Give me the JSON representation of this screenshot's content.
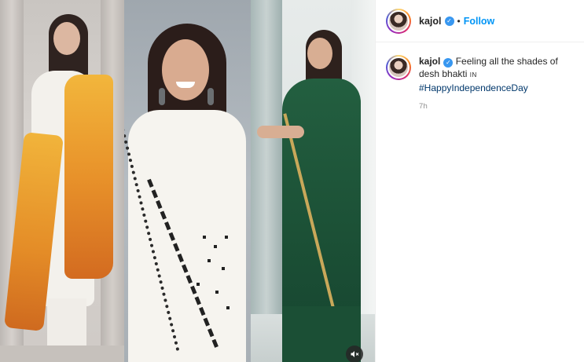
{
  "post": {
    "author": {
      "username": "kajol",
      "verified_icon": "verified-badge-icon",
      "follow_label": "Follow",
      "separator": "•"
    },
    "caption": {
      "username": "kajol",
      "text": "Feeling all the shades of desh bhakti",
      "in_tag": "IN",
      "hashtag": "#HappyIndependenceDay",
      "time": "7h"
    },
    "media": {
      "panels": [
        "photo-panel-orange-dupatta",
        "photo-panel-white-outfit",
        "photo-panel-green-saree"
      ],
      "mute_icon": "muted-speaker-icon"
    }
  },
  "colors": {
    "follow_blue": "#0095f6",
    "verified_blue": "#3897f0",
    "hashtag": "#00376b",
    "meta_gray": "#8e8e8e",
    "saree_green": "#1f5a3c",
    "dupatta_orange": "#e49a28"
  }
}
